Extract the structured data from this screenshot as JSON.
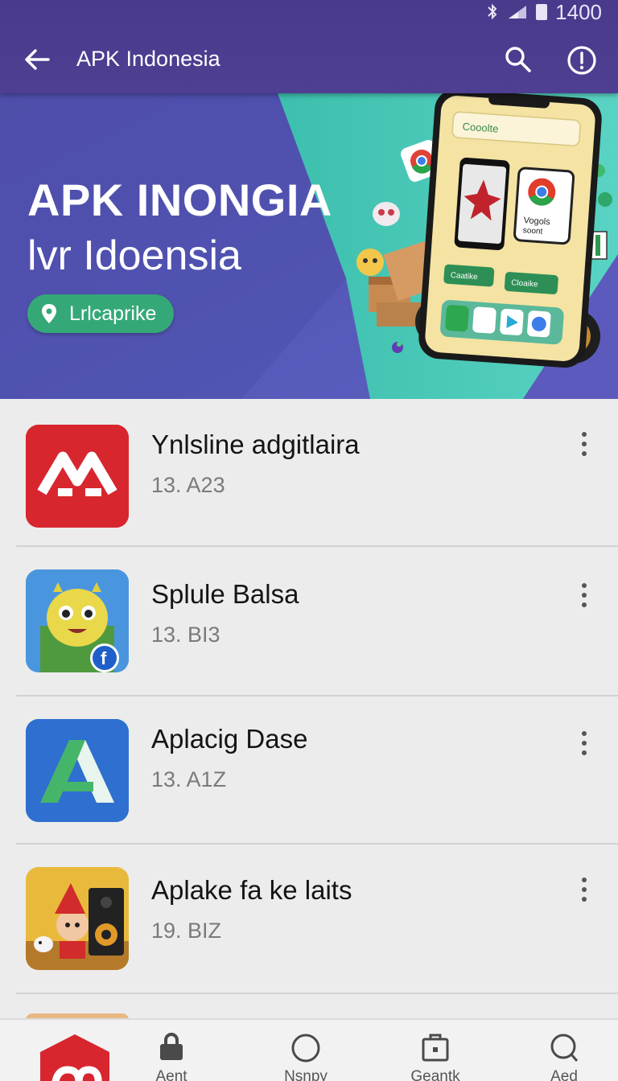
{
  "status_bar": {
    "time": "1400"
  },
  "app_bar": {
    "title": "APK Indonesia"
  },
  "hero": {
    "title": "APK INONGIA",
    "subtitle": "lvr Idoensia",
    "chip_label": "Lrlcaprike",
    "phone_search_text": "Cooolte",
    "phone_card_text": "Vogols\nsoont",
    "phone_button_left": "Caatike",
    "phone_button_right": "Cloaike"
  },
  "apps": [
    {
      "name": "Ynlsline adgitlaira",
      "version": "13. A23",
      "icon": "red-monogram-icon"
    },
    {
      "name": "Splule Balsa",
      "version": "13. BI3",
      "icon": "android-mascot-icon"
    },
    {
      "name": "Aplacig Dase",
      "version": "13. A1Z",
      "icon": "letter-a-icon"
    },
    {
      "name": "Aplake fa ke laits",
      "version": "19. BIZ",
      "icon": "cartoon-speaker-icon"
    }
  ],
  "bottom_nav": [
    {
      "label": "Aent",
      "icon": "bag-icon"
    },
    {
      "label": "Nsnpy",
      "icon": "circle-icon"
    },
    {
      "label": "Geantk",
      "icon": "briefcase-icon"
    },
    {
      "label": "Aed",
      "icon": "search-icon"
    }
  ],
  "colors": {
    "app_bar": "#4a3a8c",
    "hero": "#5656b4",
    "accent_green": "#35a878",
    "brand_red": "#d8262f"
  }
}
